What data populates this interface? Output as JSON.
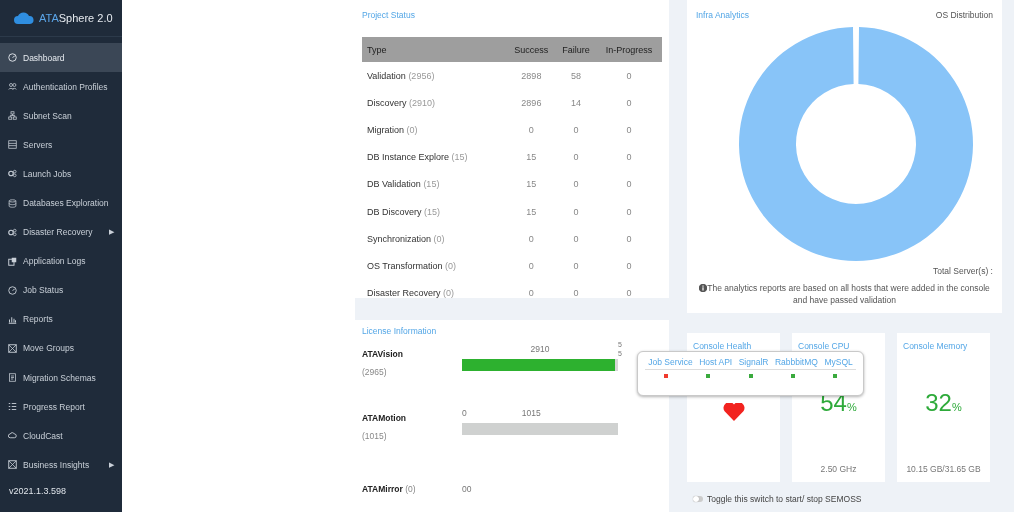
{
  "sidebar": {
    "logo": "ATA",
    "logo_rest": "Sphere 2.0",
    "items": [
      {
        "label": "Dashboard",
        "selected": true
      },
      {
        "label": "Authentication Profiles",
        "selected": false
      },
      {
        "label": "Subnet Scan",
        "selected": false
      },
      {
        "label": "Servers",
        "selected": false
      },
      {
        "label": "Launch Jobs",
        "selected": false
      },
      {
        "label": "Databases Exploration",
        "selected": false
      },
      {
        "label": "Disaster Recovery",
        "selected": false,
        "arrow": "▶"
      },
      {
        "label": "Application Logs",
        "selected": false
      },
      {
        "label": "Job Status",
        "selected": false
      },
      {
        "label": "Reports",
        "selected": false
      },
      {
        "label": "Move Groups",
        "selected": false
      },
      {
        "label": "Migration Schemas",
        "selected": false
      },
      {
        "label": "Progress Report",
        "selected": false
      },
      {
        "label": "CloudCast",
        "selected": false
      },
      {
        "label": "Business Insights",
        "selected": false,
        "arrow": "▶"
      }
    ],
    "version": "v2021.1.3.598"
  },
  "project_status": {
    "title": "Project Status",
    "columns": [
      "Type",
      "Success",
      "Failure",
      "In-Progress"
    ],
    "rows": [
      {
        "type": "Validation",
        "count": "(2956)",
        "success": "2898",
        "failure": "58",
        "in_progress": "0"
      },
      {
        "type": "Discovery",
        "count": "(2910)",
        "success": "2896",
        "failure": "14",
        "in_progress": "0"
      },
      {
        "type": "Migration",
        "count": "(0)",
        "success": "0",
        "failure": "0",
        "in_progress": "0"
      },
      {
        "type": "DB Instance Explore",
        "count": "(15)",
        "success": "15",
        "failure": "0",
        "in_progress": "0"
      },
      {
        "type": "DB Validation",
        "count": "(15)",
        "success": "15",
        "failure": "0",
        "in_progress": "0"
      },
      {
        "type": "DB Discovery",
        "count": "(15)",
        "success": "15",
        "failure": "0",
        "in_progress": "0"
      },
      {
        "type": "Synchronization",
        "count": "(0)",
        "success": "0",
        "failure": "0",
        "in_progress": "0"
      },
      {
        "type": "OS Transformation",
        "count": "(0)",
        "success": "0",
        "failure": "0",
        "in_progress": "0"
      },
      {
        "type": "Disaster Recovery",
        "count": "(0)",
        "success": "0",
        "failure": "0",
        "in_progress": "0"
      }
    ]
  },
  "license": {
    "title": "License Information",
    "products": [
      {
        "name": "ATAVision",
        "count": "(2965)",
        "kind": "active",
        "level": 0.98,
        "scale": [
          "2910"
        ],
        "end_marks": [
          "5",
          "5"
        ]
      },
      {
        "name": "ATAMotion",
        "count": "(1015)",
        "kind": "unused",
        "level": 1,
        "scale": [
          "0",
          "1015"
        ]
      },
      {
        "name": "ATAMirror",
        "count": "(0)",
        "kind": "empty",
        "scale": [
          "00"
        ]
      }
    ]
  },
  "infra": {
    "title": "Infra Analytics",
    "subtitle": "OS Distribution",
    "total_label": "Total Server(s) :",
    "note": "The analytics reports are based on all hosts that were added in the console and have passed validation"
  },
  "console_health": {
    "title": "Console Health",
    "services": [
      {
        "name": "Job Service",
        "color": "#f03a2e"
      },
      {
        "name": "Host API",
        "color": "#3aaa3e"
      },
      {
        "name": "SignalR",
        "color": "#3aaa3e"
      },
      {
        "name": "RabbbitMQ",
        "color": "#3aaa3e"
      },
      {
        "name": "MySQL",
        "color": "#3aaa3e"
      }
    ]
  },
  "console_cpu": {
    "title": "Console CPU",
    "value": "54",
    "unit": "%",
    "detail": "2.50 GHz"
  },
  "console_memory": {
    "title": "Console Memory",
    "value": "32",
    "unit": "%",
    "detail": "10.15 GB/31.65 GB"
  },
  "semoss_toggle": {
    "label": "Toggle this switch to start/ stop SEMOSS",
    "on": false
  }
}
